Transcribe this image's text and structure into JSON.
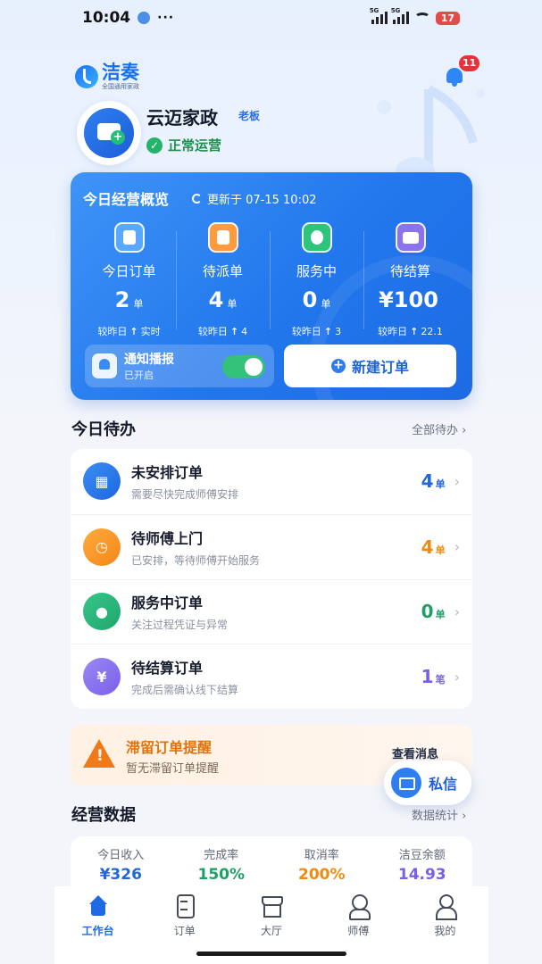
{
  "status_bar": {
    "time": "10:04",
    "more": "···",
    "net1": "5G",
    "net2": "5G",
    "battery": "17"
  },
  "brand": {
    "name": "洁奏",
    "subtitle": "全国通用家政"
  },
  "notifications": {
    "badge": "11"
  },
  "profile": {
    "company": "云迈家政",
    "role": "老板",
    "status": "正常运营"
  },
  "overview": {
    "title": "今日经营概览",
    "updated": "更新于 07-15 10:02",
    "stats": [
      {
        "label": "今日订单",
        "value": "2",
        "unit": "单",
        "trend_label": "较昨日",
        "trend_value": "实时",
        "icon": "clipboard-icon",
        "color": "#5aa8ff"
      },
      {
        "label": "待派单",
        "value": "4",
        "unit": "单",
        "trend_label": "较昨日",
        "trend_value": "4",
        "icon": "dispatch-icon",
        "color": "#ff9a3d"
      },
      {
        "label": "服务中",
        "value": "0",
        "unit": "单",
        "trend_label": "较昨日",
        "trend_value": "3",
        "icon": "worker-icon",
        "color": "#2fc47e"
      },
      {
        "label": "待结算",
        "value": "¥100",
        "unit": "",
        "trend_label": "较昨日",
        "trend_value": "22.1",
        "icon": "wallet-icon",
        "color": "#8b73f0"
      }
    ],
    "notify": {
      "title": "通知播报",
      "subtitle": "已开启",
      "enabled": true
    },
    "new_order_label": "新建订单"
  },
  "todo": {
    "title": "今日待办",
    "link": "全部待办 ›",
    "items": [
      {
        "title": "未安排订单",
        "subtitle": "需要尽快完成师傅安排",
        "count": "4",
        "unit": "单",
        "icon": "calendar-icon",
        "color": "blue",
        "glyph": "▦"
      },
      {
        "title": "待师傅上门",
        "subtitle": "已安排，等待师傅开始服务",
        "count": "4",
        "unit": "单",
        "icon": "clock-icon",
        "color": "orange",
        "glyph": "◷"
      },
      {
        "title": "服务中订单",
        "subtitle": "关注过程凭证与异常",
        "count": "0",
        "unit": "单",
        "icon": "worker-icon",
        "color": "green",
        "glyph": "●"
      },
      {
        "title": "待结算订单",
        "subtitle": "完成后需确认线下结算",
        "count": "1",
        "unit": "笔",
        "icon": "yen-icon",
        "color": "purple",
        "glyph": "¥"
      }
    ]
  },
  "alert": {
    "title": "滞留订单提醒",
    "subtitle": "暂无滞留订单提醒",
    "action": "查看消息"
  },
  "private_message": {
    "label": "私信"
  },
  "business": {
    "title": "经营数据",
    "link": "数据统计 ›",
    "items": [
      {
        "label": "今日收入",
        "value": "¥326",
        "color": "#2166da"
      },
      {
        "label": "完成率",
        "value": "150%",
        "color": "#1ea066"
      },
      {
        "label": "取消率",
        "value": "200%",
        "color": "#f08a13"
      },
      {
        "label": "洁豆余额",
        "value": "14.93",
        "color": "#7a5fe8"
      }
    ]
  },
  "tabs": [
    {
      "label": "工作台",
      "icon": "home-icon",
      "active": true
    },
    {
      "label": "订单",
      "icon": "document-icon",
      "active": false
    },
    {
      "label": "大厅",
      "icon": "shop-icon",
      "active": false
    },
    {
      "label": "师傅",
      "icon": "worker-icon",
      "active": false
    },
    {
      "label": "我的",
      "icon": "person-icon",
      "active": false
    }
  ]
}
